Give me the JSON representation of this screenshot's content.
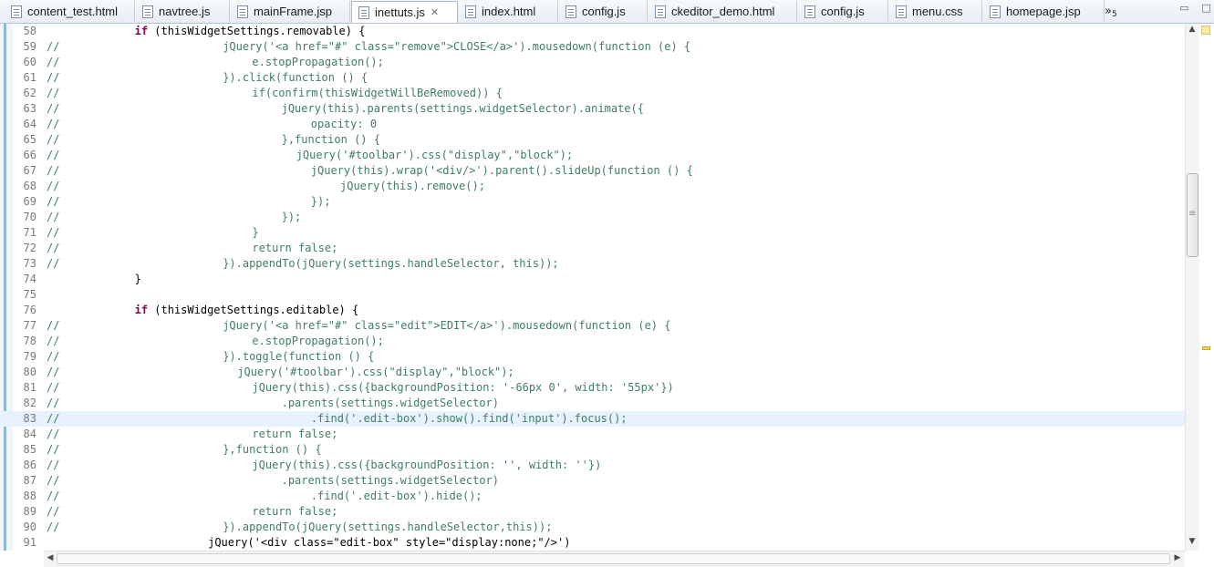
{
  "tabs": [
    {
      "label": "content_test.html"
    },
    {
      "label": "navtree.js"
    },
    {
      "label": "mainFrame.jsp"
    },
    {
      "label": "inettuts.js",
      "active": true
    },
    {
      "label": "index.html"
    },
    {
      "label": "config.js"
    },
    {
      "label": "ckeditor_demo.html"
    },
    {
      "label": "config.js"
    },
    {
      "label": "menu.css"
    },
    {
      "label": "homepage.jsp"
    }
  ],
  "tab_overflow": {
    "chevron": "»",
    "count": "5"
  },
  "window_controls": {
    "minimize": "▭",
    "maximize": "□"
  },
  "tab_close_glyph": "✕",
  "colors": {
    "keyword": "#7f0055",
    "comment": "#3f7f5f",
    "string": "#2a00ff",
    "current_line": "#e8f2fe"
  },
  "editor": {
    "lines": [
      {
        "num": "58",
        "comment": false,
        "indent": 12,
        "text": "if (thisWidgetSettings.removable) {"
      },
      {
        "num": "59",
        "comment": true,
        "indent": 24,
        "text": "jQuery('<a href=\"#\" class=\"remove\">CLOSE</a>').mousedown(function (e) {"
      },
      {
        "num": "60",
        "comment": true,
        "indent": 28,
        "text": "e.stopPropagation();"
      },
      {
        "num": "61",
        "comment": true,
        "indent": 24,
        "text": "}).click(function () {"
      },
      {
        "num": "62",
        "comment": true,
        "indent": 28,
        "text": "if(confirm(thisWidgetWillBeRemoved)) {"
      },
      {
        "num": "63",
        "comment": true,
        "indent": 32,
        "text": "jQuery(this).parents(settings.widgetSelector).animate({"
      },
      {
        "num": "64",
        "comment": true,
        "indent": 36,
        "text": "opacity: 0"
      },
      {
        "num": "65",
        "comment": true,
        "indent": 32,
        "text": "},function () {"
      },
      {
        "num": "66",
        "comment": true,
        "indent": 34,
        "text": "jQuery('#toolbar').css(\"display\",\"block\");"
      },
      {
        "num": "67",
        "comment": true,
        "indent": 36,
        "text": "jQuery(this).wrap('<div/>').parent().slideUp(function () {"
      },
      {
        "num": "68",
        "comment": true,
        "indent": 40,
        "text": "jQuery(this).remove();"
      },
      {
        "num": "69",
        "comment": true,
        "indent": 36,
        "text": "});"
      },
      {
        "num": "70",
        "comment": true,
        "indent": 32,
        "text": "});"
      },
      {
        "num": "71",
        "comment": true,
        "indent": 28,
        "text": "}"
      },
      {
        "num": "72",
        "comment": true,
        "indent": 28,
        "text": "return false;"
      },
      {
        "num": "73",
        "comment": true,
        "indent": 24,
        "text": "}).appendTo(jQuery(settings.handleSelector, this));"
      },
      {
        "num": "74",
        "comment": false,
        "indent": 12,
        "text": "}"
      },
      {
        "num": "75",
        "comment": false,
        "indent": 0,
        "text": ""
      },
      {
        "num": "76",
        "comment": false,
        "indent": 12,
        "text": "if (thisWidgetSettings.editable) {"
      },
      {
        "num": "77",
        "comment": true,
        "indent": 24,
        "text": "jQuery('<a href=\"#\" class=\"edit\">EDIT</a>').mousedown(function (e) {"
      },
      {
        "num": "78",
        "comment": true,
        "indent": 28,
        "text": "e.stopPropagation();"
      },
      {
        "num": "79",
        "comment": true,
        "indent": 24,
        "text": "}).toggle(function () {"
      },
      {
        "num": "80",
        "comment": true,
        "indent": 26,
        "text": "jQuery('#toolbar').css(\"display\",\"block\");"
      },
      {
        "num": "81",
        "comment": true,
        "indent": 28,
        "text": "jQuery(this).css({backgroundPosition: '-66px 0', width: '55px'})"
      },
      {
        "num": "82",
        "comment": true,
        "indent": 32,
        "text": ".parents(settings.widgetSelector)"
      },
      {
        "num": "83",
        "comment": true,
        "indent": 36,
        "text": ".find('.edit-box').show().find('input').focus();",
        "current": true
      },
      {
        "num": "84",
        "comment": true,
        "indent": 28,
        "text": "return false;"
      },
      {
        "num": "85",
        "comment": true,
        "indent": 24,
        "text": "},function () {"
      },
      {
        "num": "86",
        "comment": true,
        "indent": 28,
        "text": "jQuery(this).css({backgroundPosition: '', width: ''})"
      },
      {
        "num": "87",
        "comment": true,
        "indent": 32,
        "text": ".parents(settings.widgetSelector)"
      },
      {
        "num": "88",
        "comment": true,
        "indent": 36,
        "text": ".find('.edit-box').hide();"
      },
      {
        "num": "89",
        "comment": true,
        "indent": 28,
        "text": "return false;"
      },
      {
        "num": "90",
        "comment": true,
        "indent": 24,
        "text": "}).appendTo(jQuery(settings.handleSelector,this));"
      },
      {
        "num": "91",
        "comment": false,
        "indent": 22,
        "text": "jQuery('<div class=\"edit-box\" style=\"display:none;\"/>')"
      }
    ]
  },
  "scroll_arrows": {
    "up": "▲",
    "down": "▼",
    "left": "◀",
    "right": "▶"
  }
}
